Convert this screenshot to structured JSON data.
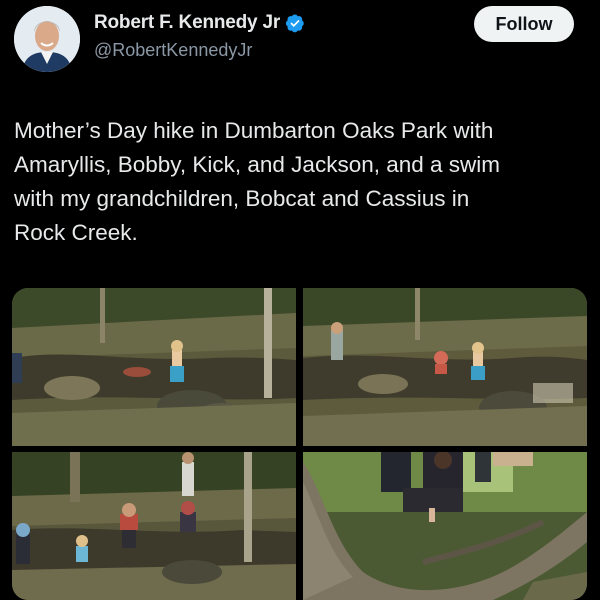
{
  "author": {
    "display_name": "Robert F. Kennedy Jr",
    "handle": "@RobertKennedyJr",
    "avatar_icon": "profile-photo",
    "verified_icon": "verified-badge-icon",
    "verified_color": "#1d9bf0"
  },
  "actions": {
    "follow_label": "Follow"
  },
  "post": {
    "text": "Mother’s Day hike in Dumbarton Oaks Park with\nAmaryllis, Bobby, Kick, and Jackson, and a swim\nwith my grandchildren, Bobcat and Cassius in\nRock Creek."
  },
  "media": {
    "count": 4
  },
  "colors": {
    "background": "#000000",
    "text": "#e7e9ea",
    "secondary_text": "#8b98a5",
    "button_bg": "#eff3f4"
  }
}
